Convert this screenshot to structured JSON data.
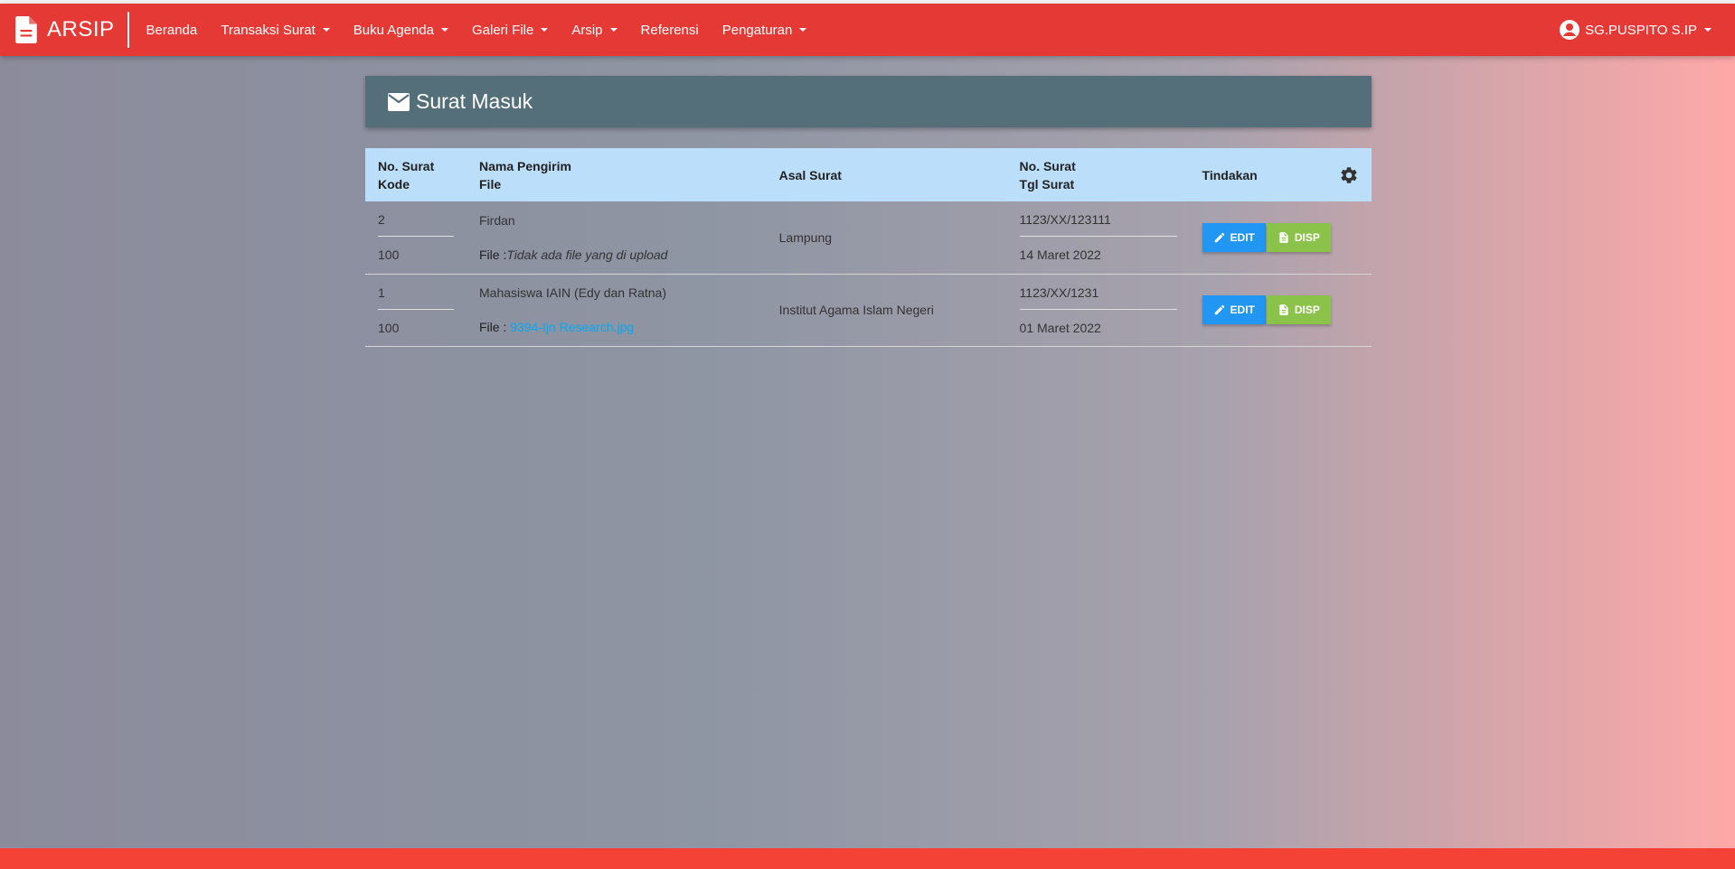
{
  "app": {
    "title": "ARSIP"
  },
  "nav": {
    "items": [
      {
        "label": "Beranda",
        "dropdown": false
      },
      {
        "label": "Transaksi Surat",
        "dropdown": true
      },
      {
        "label": "Buku Agenda",
        "dropdown": true
      },
      {
        "label": "Galeri File",
        "dropdown": true
      },
      {
        "label": "Arsip",
        "dropdown": true
      },
      {
        "label": "Referensi",
        "dropdown": false
      },
      {
        "label": "Pengaturan",
        "dropdown": true
      }
    ],
    "user": "SG.PUSPITO S.IP"
  },
  "page": {
    "title": "Surat Masuk",
    "icon": "mail-icon"
  },
  "table": {
    "headers": {
      "col1_a": "No. Surat",
      "col1_b": "Kode",
      "col2_a": "Nama Pengirim",
      "col2_b": "File",
      "col3": "Asal Surat",
      "col4_a": "No. Surat",
      "col4_b": "Tgl Surat",
      "col5": "Tindakan"
    },
    "file_label": "File :",
    "edit_label": "EDIT",
    "disp_label": "DISP",
    "rows": [
      {
        "no": "2",
        "kode": "100",
        "pengirim": "Firdan",
        "file_none": "Tidak ada file yang di upload",
        "asal": "Lampung",
        "no_surat": "1123/XX/123111",
        "tgl": "14 Maret 2022"
      },
      {
        "no": "1",
        "kode": "100",
        "pengirim": "Mahasiswa IAIN (Edy dan Ratna)",
        "file_link": "9394-Ijn Research.jpg",
        "asal": "Institut Agama Islam Negeri",
        "no_surat": "1123/XX/1231",
        "tgl": "01 Maret 2022"
      }
    ]
  },
  "colors": {
    "navbar": "#e53935",
    "title_card": "#546e7a",
    "table_header": "#bbdefb",
    "edit_button": "#2196f3",
    "disp_button": "#8bc34a",
    "link": "#03a9f4"
  }
}
